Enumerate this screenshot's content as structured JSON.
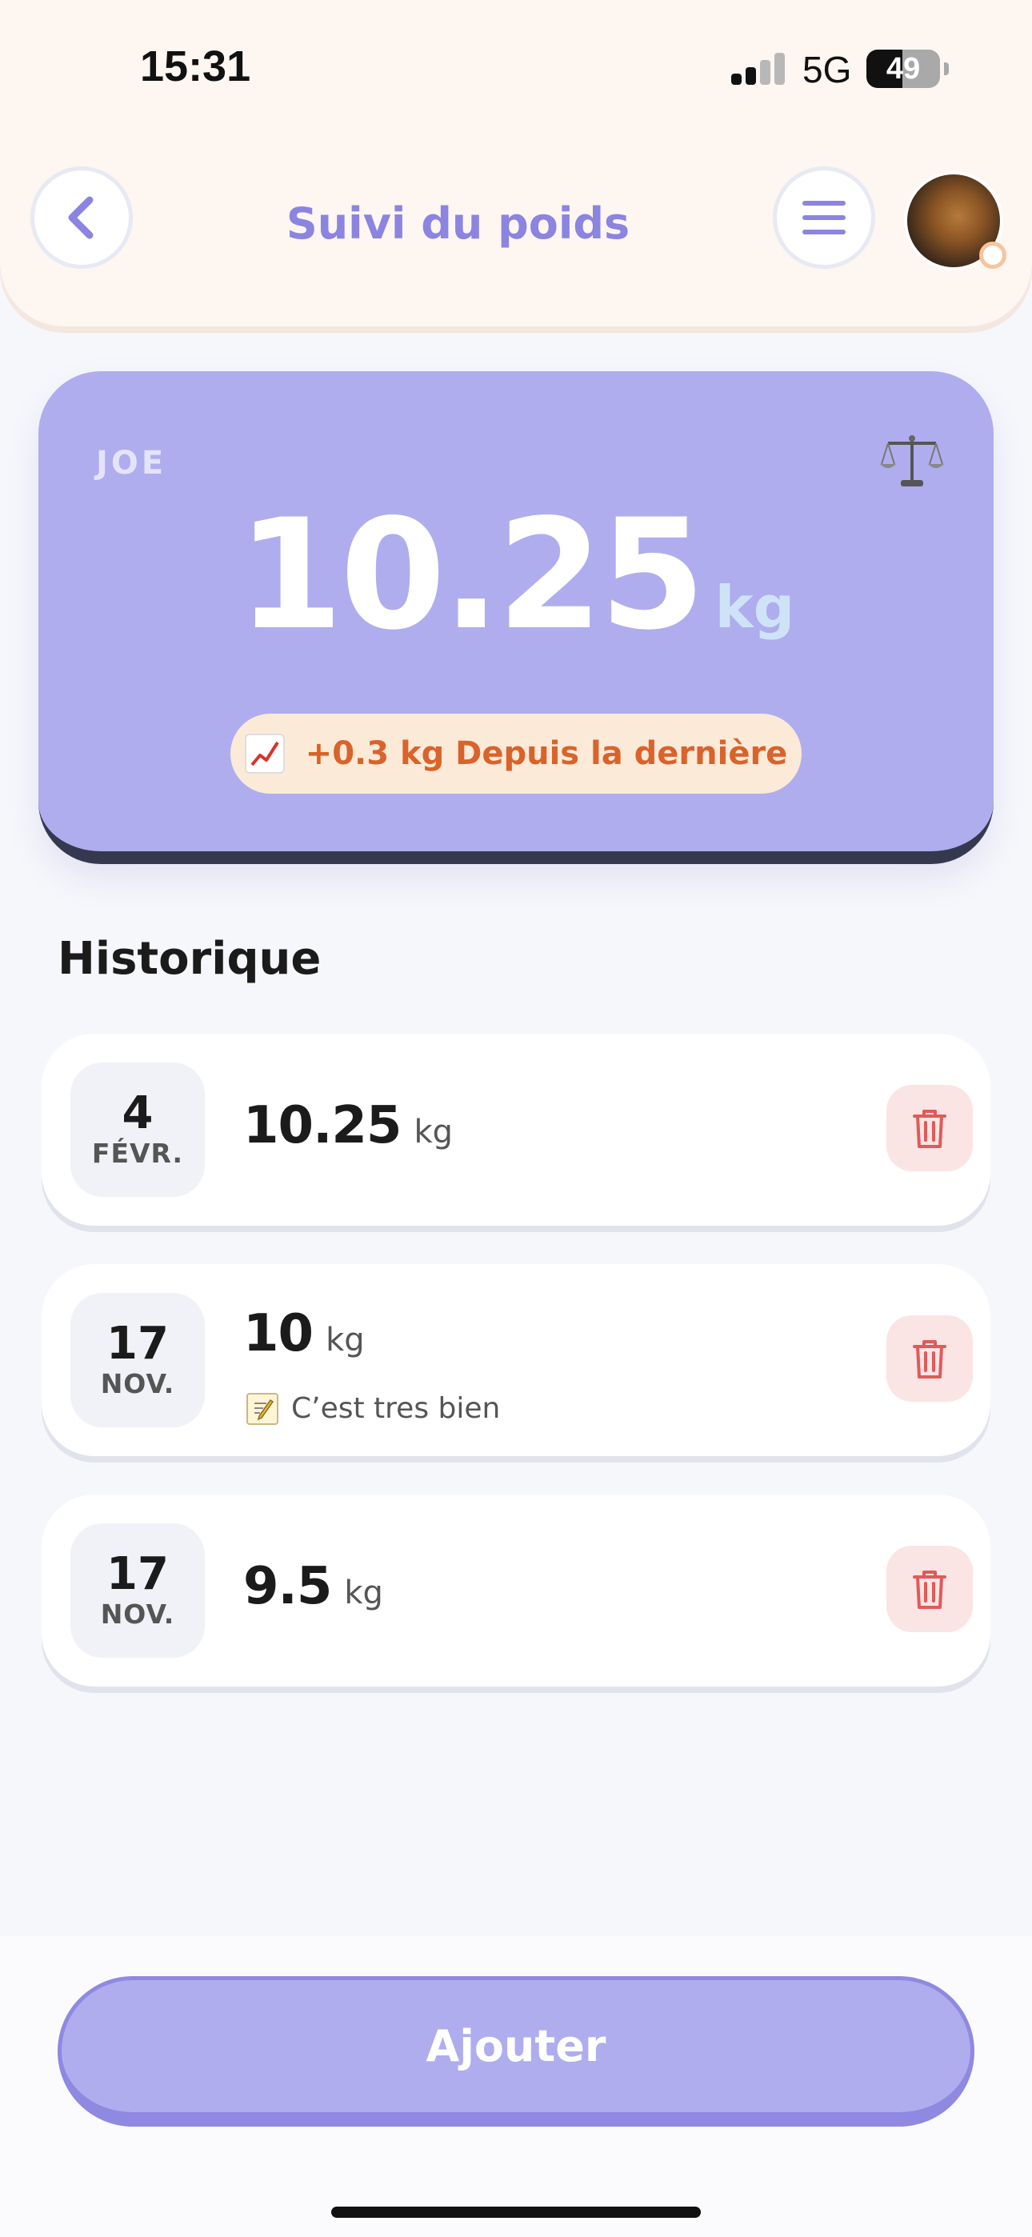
{
  "status_bar": {
    "time": "15:31",
    "network": "5G",
    "battery": "49",
    "battery_level": 0.49
  },
  "header": {
    "title": "Suivi du poids",
    "back_icon": "chevron-left-icon",
    "menu_icon": "hamburger-menu-icon",
    "avatar": "dog-photo-avatar"
  },
  "summary": {
    "pet_name": "JOE",
    "weight": "10.25",
    "unit": "kg",
    "icon": "balance-scale-icon",
    "delta_icon": "chart-increasing-icon",
    "delta_text": "+0.3 kg Depuis la dernière"
  },
  "history": {
    "title": "Historique",
    "entries": [
      {
        "day": "4",
        "month": "FÉVR.",
        "weight": "10.25",
        "unit": "kg",
        "note": ""
      },
      {
        "day": "17",
        "month": "NOV.",
        "weight": "10",
        "unit": "kg",
        "note": "C’est tres bien"
      },
      {
        "day": "17",
        "month": "NOV.",
        "weight": "9.5",
        "unit": "kg",
        "note": ""
      }
    ]
  },
  "actions": {
    "add_label": "Ajouter"
  },
  "colors": {
    "accent": "#afadee",
    "accent_dark": "#8b84e0",
    "delta_text": "#d9632a",
    "delta_bg": "#fcead9",
    "delete_bg": "#fbe4e4",
    "delete_icon": "#e05a5a"
  }
}
